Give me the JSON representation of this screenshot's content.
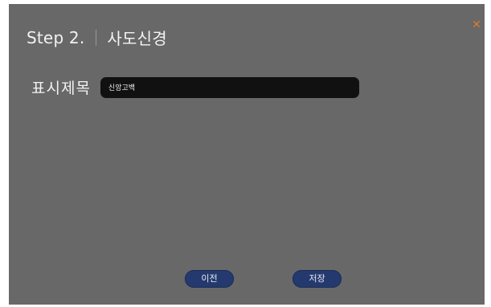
{
  "header": {
    "step": "Step 2.",
    "title": "사도신경"
  },
  "close_icon": "close-icon",
  "field": {
    "label": "표시제목",
    "value": "신앙고백"
  },
  "buttons": {
    "prev_label": "이전",
    "save_label": "저장"
  },
  "colors": {
    "panel": "#686868",
    "input_bg": "#111111",
    "button_bg": "#243a6e",
    "close_accent": "#e0782e"
  }
}
